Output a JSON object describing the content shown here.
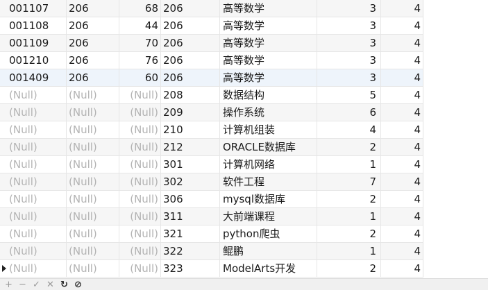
{
  "grid": {
    "rows": [
      [
        "001107",
        "206",
        "68",
        "206",
        "高等数学",
        "3",
        "4"
      ],
      [
        "001108",
        "206",
        "44",
        "206",
        "高等数学",
        "3",
        "4"
      ],
      [
        "001109",
        "206",
        "70",
        "206",
        "高等数学",
        "3",
        "4"
      ],
      [
        "001210",
        "206",
        "76",
        "206",
        "高等数学",
        "3",
        "4"
      ],
      [
        "001409",
        "206",
        "60",
        "206",
        "高等数学",
        "3",
        "4"
      ],
      [
        "(Null)",
        "(Null)",
        "(Null)",
        "208",
        "数据结构",
        "5",
        "4"
      ],
      [
        "(Null)",
        "(Null)",
        "(Null)",
        "209",
        "操作系统",
        "6",
        "4"
      ],
      [
        "(Null)",
        "(Null)",
        "(Null)",
        "210",
        "计算机组装",
        "4",
        "4"
      ],
      [
        "(Null)",
        "(Null)",
        "(Null)",
        "212",
        "ORACLE数据库",
        "2",
        "4"
      ],
      [
        "(Null)",
        "(Null)",
        "(Null)",
        "301",
        "计算机网络",
        "1",
        "4"
      ],
      [
        "(Null)",
        "(Null)",
        "(Null)",
        "302",
        "软件工程",
        "7",
        "4"
      ],
      [
        "(Null)",
        "(Null)",
        "(Null)",
        "306",
        "mysql数据库",
        "2",
        "4"
      ],
      [
        "(Null)",
        "(Null)",
        "(Null)",
        "311",
        "大前端课程",
        "1",
        "4"
      ],
      [
        "(Null)",
        "(Null)",
        "(Null)",
        "321",
        "python爬虫",
        "2",
        "4"
      ],
      [
        "(Null)",
        "(Null)",
        "(Null)",
        "322",
        "鲲鹏",
        "1",
        "4"
      ],
      [
        "(Null)",
        "(Null)",
        "(Null)",
        "323",
        "ModelArts开发",
        "2",
        "4"
      ]
    ]
  },
  "toolbar": {
    "add": "+",
    "delete": "−",
    "apply": "✓",
    "discard": "✕",
    "refresh": "↻",
    "stop": "⊘"
  }
}
